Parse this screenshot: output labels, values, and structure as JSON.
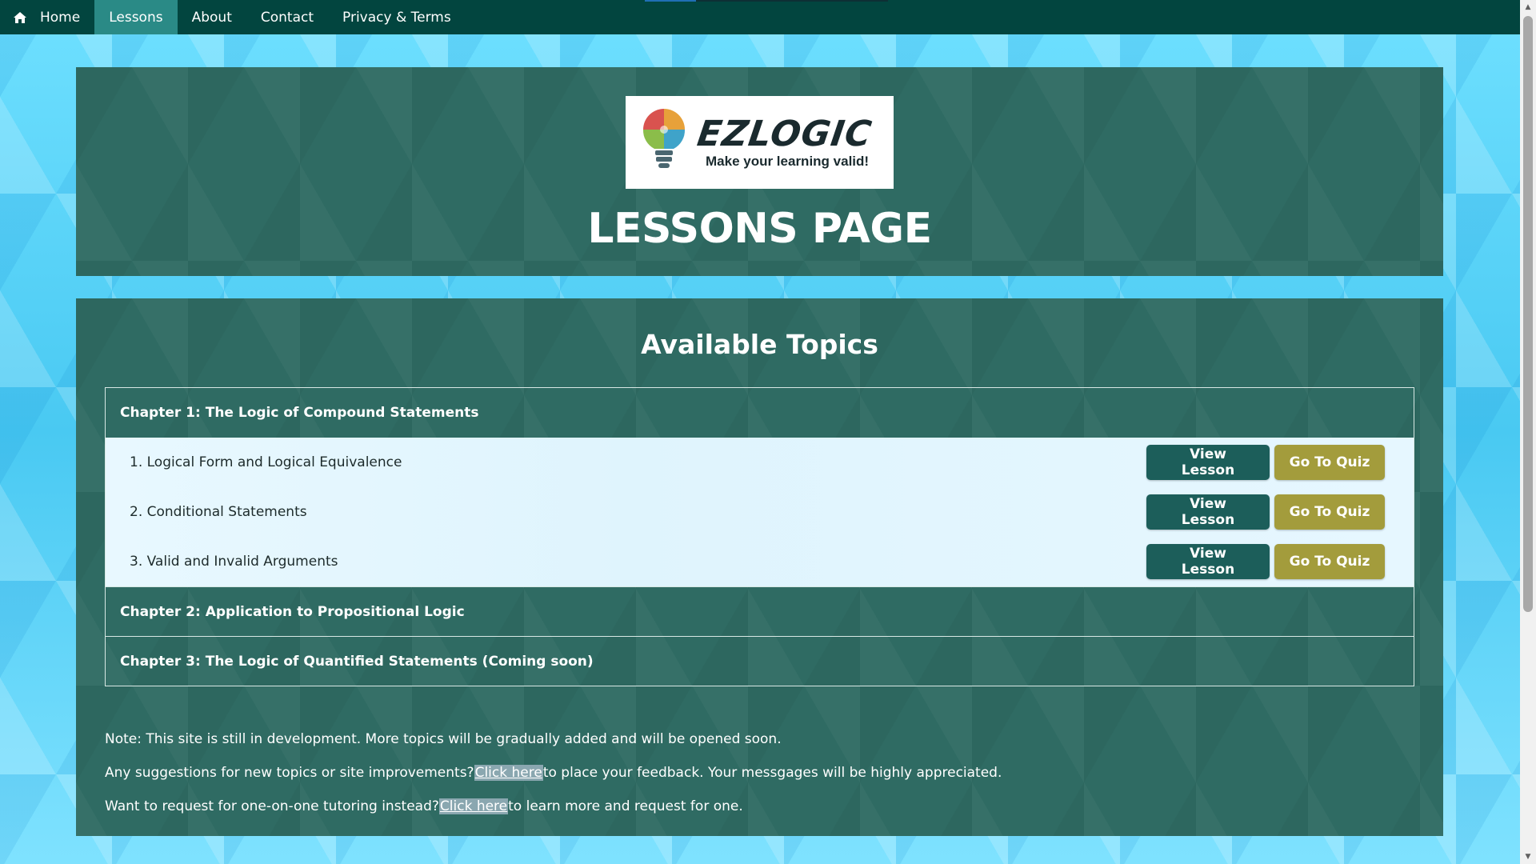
{
  "nav": {
    "items": [
      {
        "label": "Home",
        "icon": "home-icon"
      },
      {
        "label": "Lessons"
      },
      {
        "label": "About"
      },
      {
        "label": "Contact"
      },
      {
        "label": "Privacy & Terms"
      }
    ],
    "active": "Lessons"
  },
  "header": {
    "logo_text": "EZLOGIC",
    "logo_tagline": "Make your learning valid!",
    "title": "LESSONS PAGE"
  },
  "topics": {
    "title": "Available Topics",
    "chapters": [
      {
        "title": "Chapter 1: The Logic of Compound Statements",
        "lessons": [
          {
            "name": "1. Logical Form and Logical Equivalence",
            "view_label": "View Lesson",
            "quiz_label": "Go To Quiz"
          },
          {
            "name": "2. Conditional Statements",
            "view_label": "View Lesson",
            "quiz_label": "Go To Quiz"
          },
          {
            "name": "3. Valid and Invalid Arguments",
            "view_label": "View Lesson",
            "quiz_label": "Go To Quiz"
          }
        ]
      },
      {
        "title": "Chapter 2: Application to Propositional Logic"
      },
      {
        "title": "Chapter 3: The Logic of Quantified Statements (Coming soon)"
      }
    ]
  },
  "notes": {
    "line1": "Note: This site is still in development. More topics will be gradually added and will be opened soon.",
    "line2_before": "Any suggestions for new topics or site improvements? ",
    "line2_link": "Click here",
    "line2_after": " to place your feedback. Your messgages will be highly appreciated.",
    "line3_before": "Want to request for one-on-one tutoring instead? ",
    "line3_link": "Click here",
    "line3_after": " to learn more and request for one."
  },
  "colors": {
    "navbar": "#02453f",
    "nav_active": "#2a8a86",
    "panel": "#2f6b63",
    "view_button": "#1c5e5a",
    "quiz_button": "#a39c3c"
  }
}
